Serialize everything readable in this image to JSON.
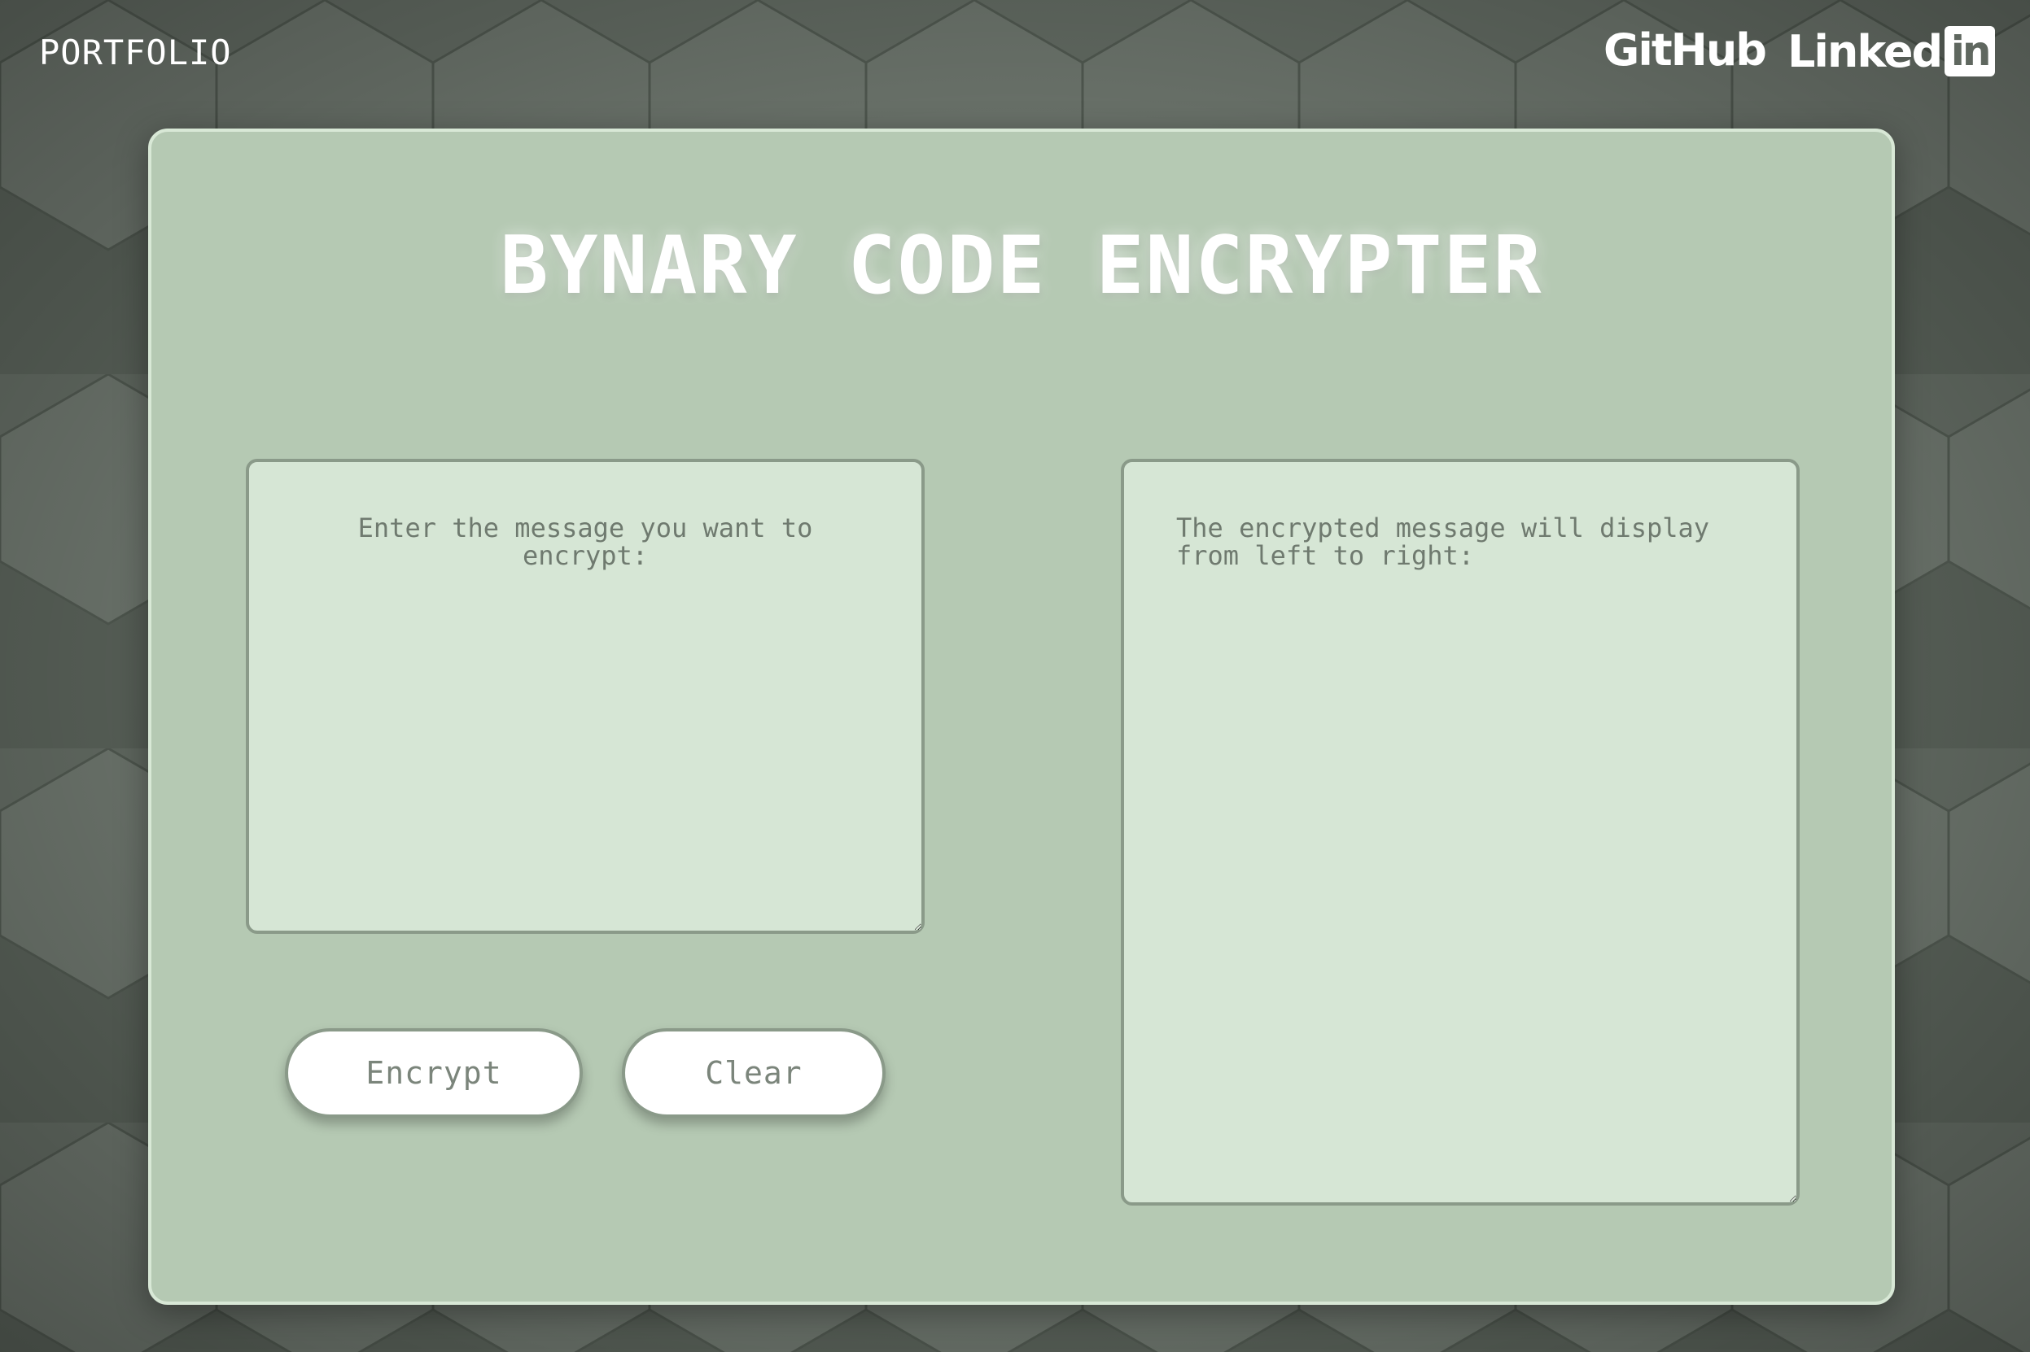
{
  "nav": {
    "portfolio_label": "PORTFOLIO",
    "github_label": "GitHub",
    "linkedin_text": "Linked",
    "linkedin_badge": "in"
  },
  "main": {
    "title": "BYNARY CODE ENCRYPTER",
    "input": {
      "placeholder": "Enter the message you want to encrypt:",
      "value": ""
    },
    "output": {
      "placeholder": "The encrypted message will display from left to right:",
      "value": ""
    },
    "buttons": {
      "encrypt_label": "Encrypt",
      "clear_label": "Clear"
    }
  },
  "icons": {
    "github": "github-wordmark-icon",
    "linkedin": "linkedin-logo-icon"
  },
  "colors": {
    "background": "#5f675f",
    "card": "#b5c9b3",
    "card_border": "#d8e8d6",
    "textbox": "#d6e6d5",
    "textbox_border": "#8a9a89",
    "button": "#ffffff",
    "title": "#ffffff"
  }
}
